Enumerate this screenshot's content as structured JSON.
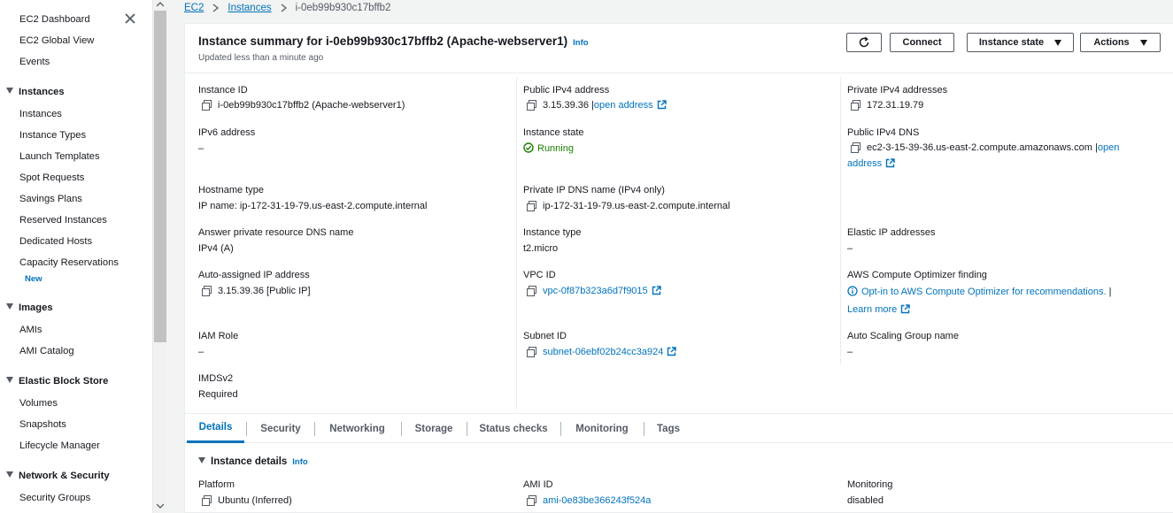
{
  "sidebar": {
    "top_items": [
      "EC2 Dashboard",
      "EC2 Global View",
      "Events"
    ],
    "instances_header": "Instances",
    "instances_items": [
      "Instances",
      "Instance Types",
      "Launch Templates",
      "Spot Requests",
      "Savings Plans",
      "Reserved Instances",
      "Dedicated Hosts",
      "Capacity Reservations"
    ],
    "new_badge": "New",
    "images_header": "Images",
    "images_items": [
      "AMIs",
      "AMI Catalog"
    ],
    "ebs_header": "Elastic Block Store",
    "ebs_items": [
      "Volumes",
      "Snapshots",
      "Lifecycle Manager"
    ],
    "network_header": "Network & Security",
    "network_items": [
      "Security Groups"
    ]
  },
  "breadcrumb": {
    "ec2": "EC2",
    "instances": "Instances",
    "current": "i-0eb99b930c17bffb2"
  },
  "header": {
    "title": "Instance summary for i-0eb99b930c17bffb2 (Apache-webserver1)",
    "info": "Info",
    "updated": "Updated less than a minute ago",
    "connect": "Connect",
    "instance_state": "Instance state",
    "actions": "Actions"
  },
  "summary": {
    "instance_id_label": "Instance ID",
    "instance_id": "i-0eb99b930c17bffb2 (Apache-webserver1)",
    "public_ipv4_label": "Public IPv4 address",
    "public_ipv4": "3.15.39.36",
    "open_address": "open address",
    "private_ipv4_label": "Private IPv4 addresses",
    "private_ipv4": "172.31.19.79",
    "ipv6_label": "IPv6 address",
    "ipv6": "–",
    "state_label": "Instance state",
    "state": "Running",
    "public_dns_label": "Public IPv4 DNS",
    "public_dns": "ec2-3-15-39-36.us-east-2.compute.amazonaws.com",
    "open": "open",
    "address": "address",
    "hostname_type_label": "Hostname type",
    "hostname_type": "IP name: ip-172-31-19-79.us-east-2.compute.internal",
    "private_dns_label": "Private IP DNS name (IPv4 only)",
    "private_dns": "ip-172-31-19-79.us-east-2.compute.internal",
    "answer_dns_label": "Answer private resource DNS name",
    "answer_dns": "IPv4 (A)",
    "instance_type_label": "Instance type",
    "instance_type": "t2.micro",
    "elastic_ip_label": "Elastic IP addresses",
    "elastic_ip": "–",
    "auto_ip_label": "Auto-assigned IP address",
    "auto_ip": "3.15.39.36 [Public IP]",
    "vpc_label": "VPC ID",
    "vpc": "vpc-0f87b323a6d7f9015",
    "optimizer_label": "AWS Compute Optimizer finding",
    "optimizer": "Opt-in to AWS Compute Optimizer for recommendations.",
    "learn_more": "Learn more",
    "iam_label": "IAM Role",
    "iam": "–",
    "subnet_label": "Subnet ID",
    "subnet": "subnet-06ebf02b24cc3a924",
    "asg_label": "Auto Scaling Group name",
    "asg": "–",
    "imds_label": "IMDSv2",
    "imds": "Required"
  },
  "tabs": [
    "Details",
    "Security",
    "Networking",
    "Storage",
    "Status checks",
    "Monitoring",
    "Tags"
  ],
  "details": {
    "title": "Instance details",
    "info": "Info",
    "platform_label": "Platform",
    "platform": "Ubuntu (Inferred)",
    "ami_label": "AMI ID",
    "ami": "ami-0e83be366243f524a",
    "monitoring_label": "Monitoring",
    "monitoring": "disabled"
  },
  "colors": {
    "link": "#0073bb",
    "running": "#1d8102",
    "text": "#16191f",
    "muted": "#545b64"
  }
}
